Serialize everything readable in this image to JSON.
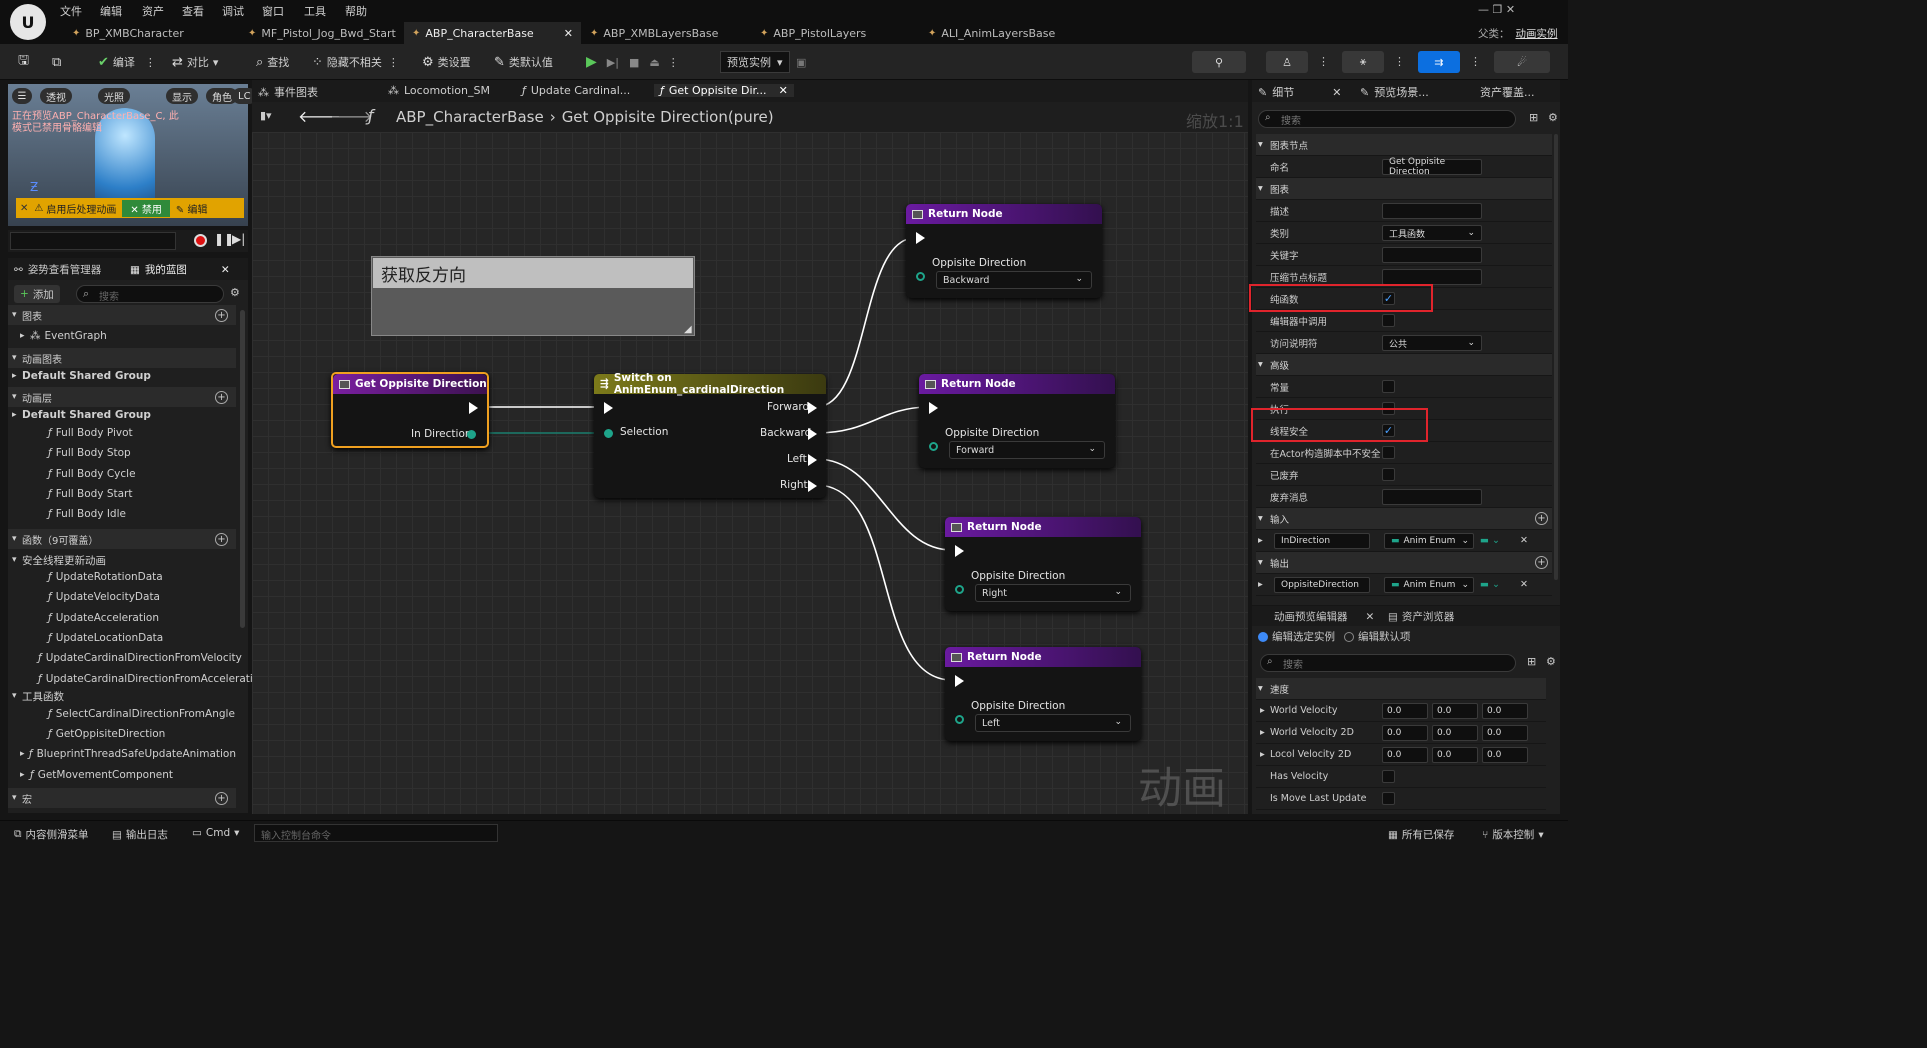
{
  "menu": [
    "文件",
    "编辑",
    "资产",
    "查看",
    "调试",
    "窗口",
    "工具",
    "帮助"
  ],
  "logo": "U",
  "window_right": {
    "parent_label": "父类：",
    "parent_value": "动画实例"
  },
  "doc_tabs": [
    "BP_XMBCharacter",
    "MF_Pistol_Jog_Bwd_Start",
    "ABP_CharacterBase",
    "ABP_XMBLayersBase",
    "ABP_PistolLayers",
    "ALI_AnimLayersBase"
  ],
  "toolbar": {
    "compile": "编译",
    "diff": "对比",
    "find": "查找",
    "hide": "隐藏不相关",
    "class_settings": "类设置",
    "class_defaults": "类默认值",
    "preview": "预览实例"
  },
  "viewport": {
    "pills": [
      "透视",
      "光照",
      "显示",
      "角色",
      "LC"
    ],
    "warning": "正在预览ABP_CharacterBase_C, 此模式已禁用骨骼编辑",
    "postprocess": "启用后处理动画",
    "disable": "禁用",
    "edit": "编辑"
  },
  "left": {
    "tab1": "姿势查看管理器",
    "tab2": "我的蓝图",
    "add": "添加",
    "search": "搜索",
    "rows": [
      {
        "t": "图表",
        "hdr": true,
        "plus": true
      },
      {
        "t": "EventGraph",
        "indent": 1
      },
      {
        "t": "动画图表",
        "hdr": true
      },
      {
        "t": "Default Shared Group",
        "bold": true
      },
      {
        "t": "动画层",
        "hdr": true,
        "plus": true
      },
      {
        "t": "Default Shared Group",
        "bold": true
      },
      {
        "t": "Full Body Pivot",
        "indent": 2
      },
      {
        "t": "Full Body Stop",
        "indent": 2
      },
      {
        "t": "Full Body Cycle",
        "indent": 2
      },
      {
        "t": "Full Body Start",
        "indent": 2
      },
      {
        "t": "Full Body Idle",
        "indent": 2
      },
      {
        "t": "函数（9可覆盖）",
        "hdr": true,
        "plus": true
      },
      {
        "t": "安全线程更新动画",
        "indent": 0
      },
      {
        "t": "UpdateRotationData",
        "indent": 2
      },
      {
        "t": "UpdateVelocityData",
        "indent": 2
      },
      {
        "t": "UpdateAcceleration",
        "indent": 2
      },
      {
        "t": "UpdateLocationData",
        "indent": 2
      },
      {
        "t": "UpdateCardinalDirectionFromVelocity",
        "indent": 2
      },
      {
        "t": "UpdateCardinalDirectionFromAcceleratio",
        "indent": 2
      },
      {
        "t": "工具函数",
        "indent": 0
      },
      {
        "t": "SelectCardinalDirectionFromAngle",
        "indent": 2
      },
      {
        "t": "GetOppisiteDirection",
        "indent": 2
      },
      {
        "t": "BlueprintThreadSafeUpdateAnimation",
        "indent": 1
      },
      {
        "t": "GetMovementComponent",
        "indent": 1
      },
      {
        "t": "宏",
        "hdr": true,
        "plus": true
      }
    ]
  },
  "graph_tabs": [
    "事件图表",
    "Locomotion_SM",
    "Update Cardinal...",
    "Get Oppisite Dir..."
  ],
  "breadcrumb": {
    "root": "ABP_CharacterBase",
    "leaf": "Get Oppisite Direction(pure)",
    "zoom": "缩放1:1"
  },
  "comment": "获取反方向",
  "nodes": {
    "entry": {
      "title": "Get Oppisite Direction",
      "pin": "In Direction"
    },
    "switch": {
      "title": "Switch on AnimEnum_cardinalDirection",
      "input": "Selection",
      "outs": [
        "Forward",
        "Backward",
        "Left",
        "Right"
      ]
    },
    "returns": [
      {
        "title": "Return Node",
        "label": "Oppisite Direction",
        "value": "Backward"
      },
      {
        "title": "Return Node",
        "label": "Oppisite Direction",
        "value": "Forward"
      },
      {
        "title": "Return Node",
        "label": "Oppisite Direction",
        "value": "Right"
      },
      {
        "title": "Return Node",
        "label": "Oppisite Direction",
        "value": "Left"
      }
    ]
  },
  "details": {
    "tab1": "细节",
    "tab2": "预览场景...",
    "tab3": "资产覆盖...",
    "search": "搜索",
    "rows": [
      {
        "t": "图表节点",
        "hdr": true
      },
      {
        "t": "命名",
        "field": "Get Oppisite Direction"
      },
      {
        "t": "图表",
        "hdr": true
      },
      {
        "t": "描述",
        "field": ""
      },
      {
        "t": "类别",
        "field": "工具函数",
        "dd": true
      },
      {
        "t": "关键字",
        "field": ""
      },
      {
        "t": "压缩节点标题",
        "field": ""
      },
      {
        "t": "纯函数",
        "cb": true,
        "checked": true
      },
      {
        "t": "编辑器中调用",
        "cb": true
      },
      {
        "t": "访问说明符",
        "field": "公共",
        "dd": true
      },
      {
        "t": "高级",
        "hdr": true
      },
      {
        "t": "常量",
        "cb": true
      },
      {
        "t": "执行",
        "cb": true
      },
      {
        "t": "线程安全",
        "cb": true,
        "checked": true
      },
      {
        "t": "在Actor构造脚本中不安全",
        "cb": true
      },
      {
        "t": "已废弃",
        "cb": true
      },
      {
        "t": "废弃消息",
        "field": ""
      },
      {
        "t": "输入",
        "hdr": true
      },
      {
        "t": "InDirection",
        "param": "Anim Enum"
      },
      {
        "t": "输出",
        "hdr": true
      },
      {
        "t": "OppisiteDirection",
        "param": "Anim Enum"
      }
    ]
  },
  "anim": {
    "tab1": "动画预览编辑器",
    "tab2": "资产浏览器",
    "opt1": "编辑选定实例",
    "opt2": "编辑默认项",
    "search": "搜索",
    "section": "速度",
    "rows": [
      {
        "t": "World Velocity",
        "v": [
          "0.0",
          "0.0",
          "0.0"
        ]
      },
      {
        "t": "World Velocity 2D",
        "v": [
          "0.0",
          "0.0",
          "0.0"
        ]
      },
      {
        "t": "Locol Velocity 2D",
        "v": [
          "0.0",
          "0.0",
          "0.0"
        ]
      },
      {
        "t": "Has Velocity",
        "cb": true
      },
      {
        "t": "Is Move Last Update",
        "cb": true
      }
    ]
  },
  "status": {
    "drawer": "内容侧滑菜单",
    "log": "输出日志",
    "cmd": "Cmd",
    "console": "输入控制台命令",
    "saved": "所有已保存",
    "vc": "版本控制"
  },
  "watermark": "动画"
}
